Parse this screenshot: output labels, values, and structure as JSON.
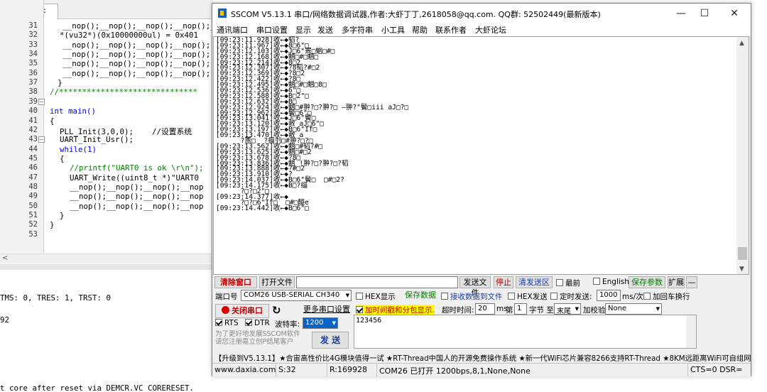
{
  "editor": {
    "tab_label": "main.c",
    "lines": [
      {
        "no": "31",
        "text": "__nop();__nop();__nop();__nop();__nop();"
      },
      {
        "no": "32",
        "text": "*(vu32*)(0x10000000ul) = 0x401"
      },
      {
        "no": "33",
        "text": "__nop();__nop();__nop();__nop();"
      },
      {
        "no": "34",
        "text": "__nop();__nop();__nop();__nop();"
      },
      {
        "no": "35",
        "text": "__nop();__nop();__nop();__nop();"
      },
      {
        "no": "36",
        "text": "__nop();__nop();__nop();__nop();"
      },
      {
        "no": "37",
        "text": "}"
      },
      {
        "no": "38",
        "text": "//******************************"
      },
      {
        "no": "39",
        "text": ""
      },
      {
        "no": "40",
        "text": "int main()"
      },
      {
        "no": "41",
        "text": "{"
      },
      {
        "no": "42",
        "text": "PLL_Init(3,0,0);    //设置系统"
      },
      {
        "no": "43",
        "text": "UART_Init_Usr();"
      },
      {
        "no": "44",
        "text": "while(1)"
      },
      {
        "no": "45",
        "text": "{"
      },
      {
        "no": "46",
        "text": "//printf(\"UART0 is ok \\r\\n\");"
      },
      {
        "no": "47",
        "text": "UART_Write((uint8_t *)\"UART0"
      },
      {
        "no": "48",
        "text": "__nop();__nop();__nop();__nop"
      },
      {
        "no": "49",
        "text": "__nop();__nop();__nop();__nop"
      },
      {
        "no": "50",
        "text": "__nop();__nop();__nop();__nop"
      },
      {
        "no": "51",
        "text": "}"
      },
      {
        "no": "52",
        "text": "}"
      },
      {
        "no": "53",
        "text": ""
      }
    ],
    "output": [
      "TMS: 0, TRES: 1, TRST: 0",
      "92",
      "t core after reset via DEMCR.VC CORERESET."
    ]
  },
  "sscom": {
    "title": "SSCOM V5.13.1 串口/网络数据调试器,作者:大虾丁丁,2618058@qq.com. QQ群: 52502449(最新版本)",
    "menu": [
      "通讯端口",
      "串口设置",
      "显示",
      "发送",
      "多字符串",
      "小工具",
      "帮助",
      "联系作者",
      "大虾论坛"
    ],
    "received": [
      "[09:23:11.928]收←◆韬?",
      "[09:23:11.967]收←◆8□6\"□",
      "[09:23:12.103]收←◆J□6\"罴□魍□#□",
      "[09:23:12.168]收←◆魍□#□魍□",
      "[09:23:12.214]收←◆8□2",
      "[09:23:12.307]收←◆?8韬?#□2",
      "[09:23:12.369]收←◆?8□2",
      "[09:23:12.422]收←◆?8□",
      "[09:23:12.495]收←◆魍□#□魍□8□",
      "[09:23:12.536]收←◆6\"□",
      "[09:23:12.588]收←◆B□2\"□",
      "[09:23:12.632]收←◆B□",
      "[09:23:12.924]收←◆魍□#翀?□?翀?□ ―翀?\"鬢□iii aJ□?□",
      "[09:23:12.962]收←◆鬢□6\"□",
      "[09:23:13.041]收←◆J□6\"鬢□",
      "[09:23:13.120]收←◆敹 aJ□6\"□",
      "[09:23:13.197]收←◆B□6\"If□",
      "[09:23:13.470]收←◆敹 a",
      "      ?蕙□  ?揊刌□#翀?□?□",
      "[09:23:13.562]收←◆魍□#韬?#□",
      "[09:23:13.625]收←◆魍□#□2",
      "[09:23:13.678]收←◆?8□",
      "[09:23:13.836]收←◆魍 !翀?□?翀?□?韬",
      "[09:23:13.888]收←◆?#□2",
      "[09:23:13.910]收←◆?",
      "[09:23:14.037]收←◆B□6\"鬢□  □#□2?",
      "[09:23:14.175]收←◆B□?缁",
      "      ?□?□2\"□",
      "[09:23:14.377]收←◆",
      "      ?□?□6\"If□  □#□醯e",
      "[09:23:14.442]收←◆B□6\"□"
    ],
    "buttons": {
      "clear": "清除窗口",
      "open_file": "打开文件",
      "send_file": "发送文件",
      "stop": "停止",
      "clear_send": "清发送区",
      "save_params": "保存参数",
      "expand": "扩展",
      "collapse": "—",
      "save_data": "保存数据",
      "recv_to_file": "接收数据到文件",
      "close_port": "关闭串口",
      "more_settings": "更多串口设置",
      "send": "发 送"
    },
    "options": {
      "topmost": "最前",
      "english": "English",
      "hex_display": "HEX显示",
      "hex_send": "HEX发送",
      "timed_send": "定时发送:",
      "timed_ms": "1000",
      "timed_unit": "ms/次",
      "add_crlf": "加回车换行",
      "timestamp": "加时间戳和分包显示.",
      "timeout_label": "超时时间:",
      "timeout_value": "20",
      "timeout_unit": "ms",
      "byte_label_1": "第",
      "byte_value": "1",
      "byte_label_2": "字节 至",
      "byte_end": "末尾",
      "checksum_label": "加校验",
      "checksum_value": "None",
      "rts": "RTS",
      "dtr": "DTR",
      "baud_label": "波特率:",
      "baud_value": "1200"
    },
    "port_label": "端口号",
    "port_value": "COM26 USB-SERIAL CH340",
    "send_text": "123456",
    "hint": "为了更好地发展SSCOM软件\n请您注册嘉立创P结尾客户",
    "promo": "【升级到V5.13.1】★合宙高性价比4G模块值得一试 ★RT-Thread中国人的开源免费操作系统 ★新一代WiFi芯片兼容8266支持RT-Thread ★8KM远距离WiFi可自组网",
    "status": {
      "site": "www.daxia.com",
      "sent": "S:32",
      "received": "R:169928",
      "port_state": "COM26 已打开  1200bps,8,1,None,None",
      "lines": "CTS=0 DSR="
    }
  }
}
